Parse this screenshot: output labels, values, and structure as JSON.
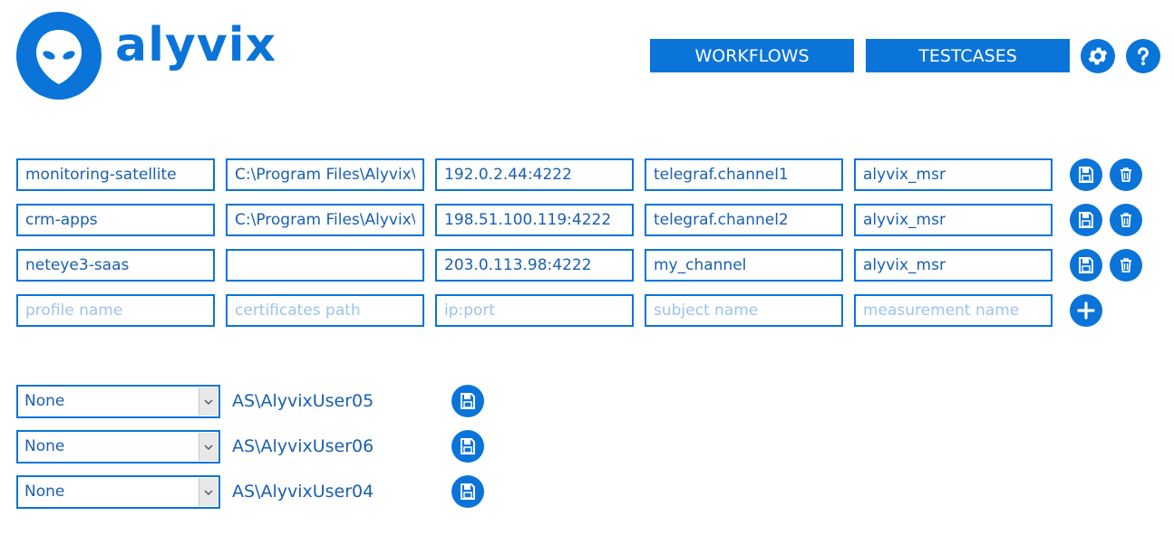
{
  "app": {
    "logo_text": "alyvix"
  },
  "nav": {
    "workflows_label": "WORKFLOWS",
    "testcases_label": "TESTCASES"
  },
  "profiles": {
    "rows": [
      {
        "name": "monitoring-satellite",
        "certs": "C:\\Program Files\\Alyvix\\Alyvix",
        "ip": "192.0.2.44:4222",
        "subject": "telegraf.channel1",
        "measurement": "alyvix_msr"
      },
      {
        "name": "crm-apps",
        "certs": "C:\\Program Files\\Alyvix\\Alyvix",
        "ip": "198.51.100.119:4222",
        "subject": "telegraf.channel2",
        "measurement": "alyvix_msr"
      },
      {
        "name": "neteye3-saas",
        "certs": "",
        "ip": "203.0.113.98:4222",
        "subject": "my_channel",
        "measurement": "alyvix_msr"
      }
    ],
    "new_row_placeholders": {
      "name": "profile name",
      "certs": "certificates path",
      "ip": "ip:port",
      "subject": "subject name",
      "measurement": "measurement name"
    }
  },
  "users": [
    {
      "selected": "None",
      "user": "AS\\AlyvixUser05"
    },
    {
      "selected": "None",
      "user": "AS\\AlyvixUser06"
    },
    {
      "selected": "None",
      "user": "AS\\AlyvixUser04"
    }
  ],
  "colors": {
    "accent": "#0a74d9",
    "text": "#1a5fb0",
    "placeholder": "#9dc3ec"
  },
  "icons": [
    "gear-icon",
    "help-icon",
    "save-icon",
    "trash-icon",
    "plus-icon",
    "chevron-down-icon",
    "alien-logo-icon"
  ]
}
